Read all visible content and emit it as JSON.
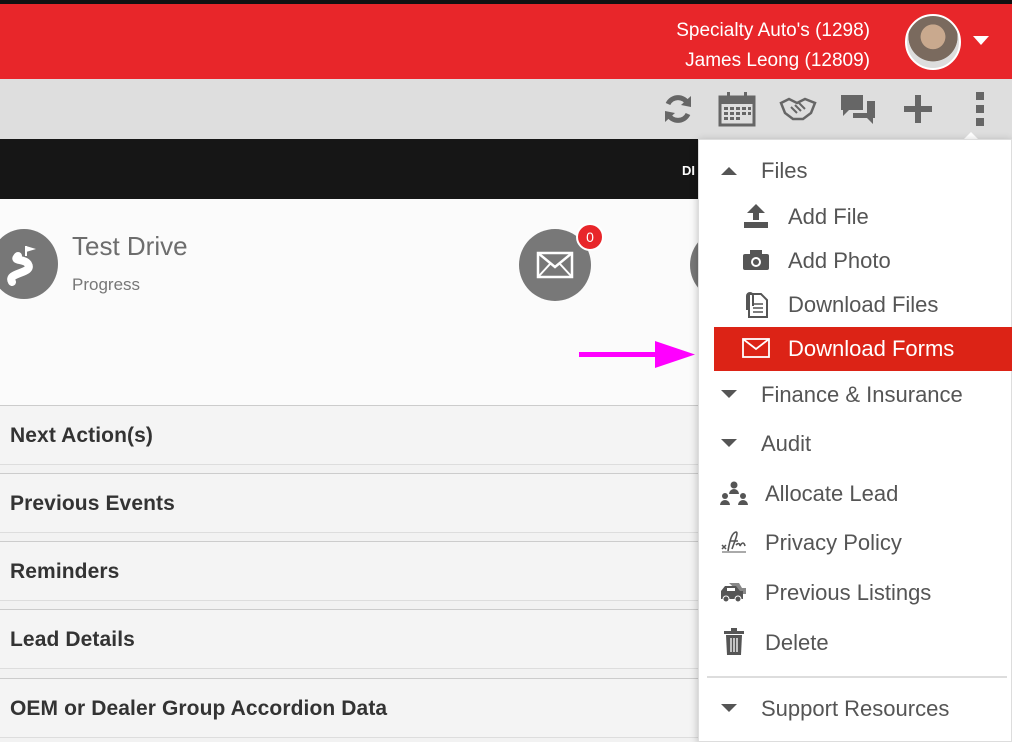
{
  "header": {
    "dealer": "Specialty Auto's (1298)",
    "user": "James Leong (12809)"
  },
  "toolbar": {
    "icons": [
      "refresh-icon",
      "calendar-icon",
      "handshake-icon",
      "chat-icon",
      "plus-icon",
      "kebab-menu-icon"
    ]
  },
  "blackbar": {
    "text": "DI"
  },
  "test_drive": {
    "title": "Test Drive",
    "subtitle": "Progress",
    "mail_badge": "0"
  },
  "accordions": [
    "Next Action(s)",
    "Previous Events",
    "Reminders",
    "Lead Details",
    "OEM or Dealer Group Accordion Data"
  ],
  "menu": {
    "files": "Files",
    "add_file": "Add File",
    "add_photo": "Add Photo",
    "download_files": "Download Files",
    "download_forms": "Download Forms",
    "finance": "Finance & Insurance",
    "audit": "Audit",
    "allocate": "Allocate Lead",
    "privacy": "Privacy Policy",
    "previous_listings": "Previous Listings",
    "delete": "Delete",
    "support": "Support Resources"
  },
  "colors": {
    "brand_red": "#e8262a",
    "active_red": "#dc2316",
    "arrow_magenta": "#ff00ff"
  }
}
